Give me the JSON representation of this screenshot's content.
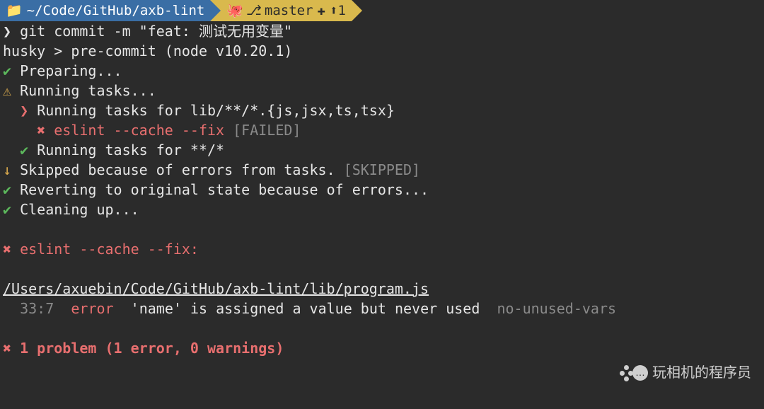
{
  "prompt": {
    "path": "~/Code/GitHub/axb-lint",
    "branch_icon": "⎇",
    "git_icon": "🐙",
    "branch": "master",
    "plus_icon": "✚",
    "up_icon": "⬆",
    "ahead": "1"
  },
  "command": {
    "prefix": "❯",
    "text": "git commit -m \"feat: 测试无用变量\""
  },
  "husky": "husky > pre-commit (node v10.20.1)",
  "tasks": {
    "preparing": "Preparing...",
    "running": "Running tasks...",
    "running_for_lib": "Running tasks for lib/**/*.{js,jsx,ts,tsx}",
    "eslint_cmd": "eslint --cache --fix",
    "failed": "[FAILED]",
    "running_for_all": "Running tasks for **/*",
    "skipped": "Skipped because of errors from tasks.",
    "skipped_tag": "[SKIPPED]",
    "reverting": "Reverting to original state because of errors...",
    "cleaning": "Cleaning up..."
  },
  "eslint_header": "eslint --cache --fix:",
  "file_path": "/Users/axuebin/Code/GitHub/axb-lint/lib/program.js",
  "lint": {
    "location": "33:7",
    "level": "error",
    "message": "'name' is assigned a value but never used",
    "rule": "no-unused-vars"
  },
  "summary": "1 problem (1 error, 0 warnings)",
  "watermark": "玩相机的程序员",
  "icons": {
    "check": "✔",
    "warn": "⚠",
    "chevron": "❯",
    "cross": "✖",
    "down_arrow": "↓"
  }
}
